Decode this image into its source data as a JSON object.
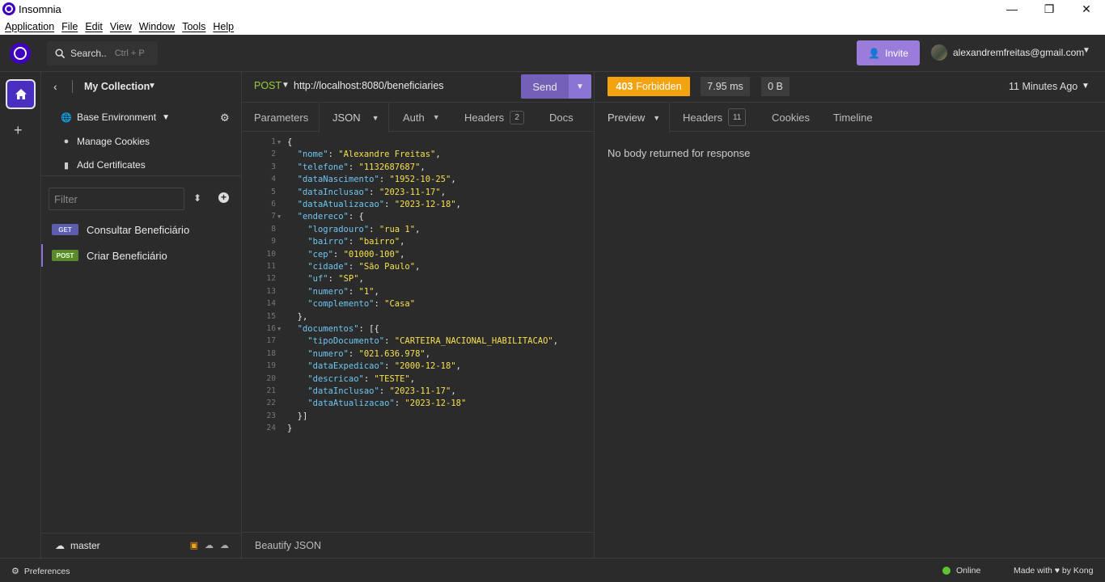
{
  "window": {
    "title": "Insomnia",
    "controls": [
      "—",
      "❐",
      "✕"
    ]
  },
  "menu": [
    "Application",
    "File",
    "Edit",
    "View",
    "Window",
    "Tools",
    "Help"
  ],
  "header": {
    "search_label": "Search..",
    "search_shortcut": "Ctrl + P",
    "invite_label": "Invite",
    "email": "alexandremfreitas@gmail.com"
  },
  "sidebar": {
    "collection": "My Collection",
    "environment": "Base Environment",
    "manage_cookies": "Manage Cookies",
    "add_certificates": "Add Certificates",
    "filter_placeholder": "Filter",
    "requests": [
      {
        "method": "GET",
        "name": "Consultar Beneficiário",
        "active": false
      },
      {
        "method": "POST",
        "name": "Criar Beneficiário",
        "active": true
      }
    ],
    "branch": "master"
  },
  "request": {
    "method": "POST",
    "url": "http://localhost:8080/beneficiaries",
    "send_label": "Send",
    "tabs": {
      "parameters": "Parameters",
      "json": "JSON",
      "auth": "Auth",
      "headers": "Headers",
      "headers_count": "2",
      "docs": "Docs"
    },
    "beautify_label": "Beautify JSON",
    "body_lines": [
      "{",
      "  \"nome\": \"Alexandre Freitas\",",
      "  \"telefone\": \"1132687687\",",
      "  \"dataNascimento\": \"1952-10-25\",",
      "  \"dataInclusao\": \"2023-11-17\",",
      "  \"dataAtualizacao\": \"2023-12-18\",",
      "  \"endereco\": {",
      "    \"logradouro\": \"rua 1\",",
      "    \"bairro\": \"bairro\",",
      "    \"cep\": \"01000-100\",",
      "    \"cidade\": \"São Paulo\",",
      "    \"uf\": \"SP\",",
      "    \"numero\": \"1\",",
      "    \"complemento\": \"Casa\"",
      "  },",
      "  \"documentos\": [{",
      "    \"tipoDocumento\": \"CARTEIRA_NACIONAL_HABILITACAO\",",
      "    \"numero\": \"021.636.978\",",
      "    \"dataExpedicao\": \"2000-12-18\",",
      "    \"descricao\": \"TESTE\",",
      "    \"dataInclusao\": \"2023-11-17\",",
      "    \"dataAtualizacao\": \"2023-12-18\"",
      "  }]",
      "}"
    ],
    "foldable_lines": [
      1,
      7,
      16
    ]
  },
  "response": {
    "status_code": "403",
    "status_text": "Forbidden",
    "time": "7.95 ms",
    "size": "0 B",
    "ago": "11 Minutes Ago",
    "tabs": {
      "preview": "Preview",
      "headers": "Headers",
      "headers_count": "11",
      "cookies": "Cookies",
      "timeline": "Timeline"
    },
    "message": "No body returned for response"
  },
  "statusbar": {
    "preferences": "Preferences",
    "online": "Online",
    "made_with": "Made with ♥ by Kong"
  },
  "colors": {
    "accent": "#4000bf",
    "status_403": "#f2a30f",
    "online": "#5ec232",
    "json_key": "#6ec6f0",
    "json_string": "#f5e050"
  }
}
